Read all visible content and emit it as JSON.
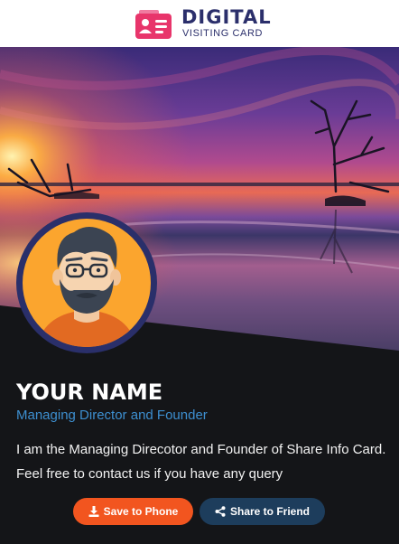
{
  "brand": {
    "title": "DIGITAL",
    "subtitle": "VISITING CARD",
    "accent": "#e8356b",
    "navy": "#2b2f6b"
  },
  "profile": {
    "name": "YOUR NAME",
    "role": "Managing Director and Founder",
    "bio": "I am the Managing Direcotor and Founder of Share Info Card. Feel free to contact us if you have any query"
  },
  "actions": {
    "save_label": "Save to Phone",
    "save_icon": "download-icon",
    "share_label": "Share to Friend",
    "share_icon": "share-icon"
  },
  "colors": {
    "background": "#141518",
    "role_text": "#3d8fd0",
    "save_button": "#f2551f",
    "share_button": "#1d3d5c",
    "avatar_ring": "#2a2f6a"
  }
}
